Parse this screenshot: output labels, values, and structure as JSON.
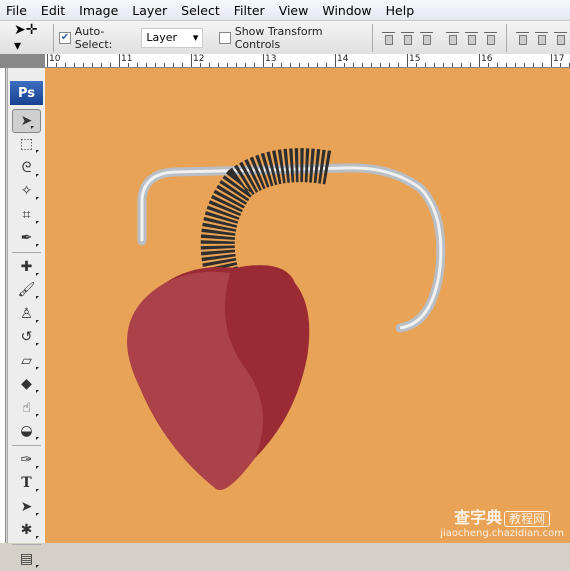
{
  "menu": [
    "File",
    "Edit",
    "Image",
    "Layer",
    "Select",
    "Filter",
    "View",
    "Window",
    "Help"
  ],
  "options": {
    "auto_select_label": "Auto-Select:",
    "auto_select_checked": true,
    "auto_select_value": "Layer",
    "show_transform_label": "Show Transform Controls",
    "show_transform_checked": false
  },
  "ruler": [
    "10",
    "11",
    "12",
    "13",
    "14",
    "15",
    "16",
    "17"
  ],
  "toolbar": {
    "logo": "Ps",
    "tools": [
      "move",
      "rectangular-marquee",
      "lasso",
      "magic-wand",
      "crop",
      "eyedropper",
      "spot-healing",
      "brush",
      "clone-stamp",
      "history-brush",
      "eraser",
      "paint-bucket",
      "smudge",
      "dodge",
      "pen",
      "type",
      "path-selection",
      "custom-shape",
      "notes"
    ]
  },
  "watermark": {
    "brand": "查字典",
    "tag": "教程网",
    "url": "jiaocheng.chazidian.com"
  },
  "colors": {
    "canvas": "#e8a356",
    "heart": "#9a2a33",
    "tube": "#2e2e2e",
    "pipe": "#c8ccd0"
  }
}
